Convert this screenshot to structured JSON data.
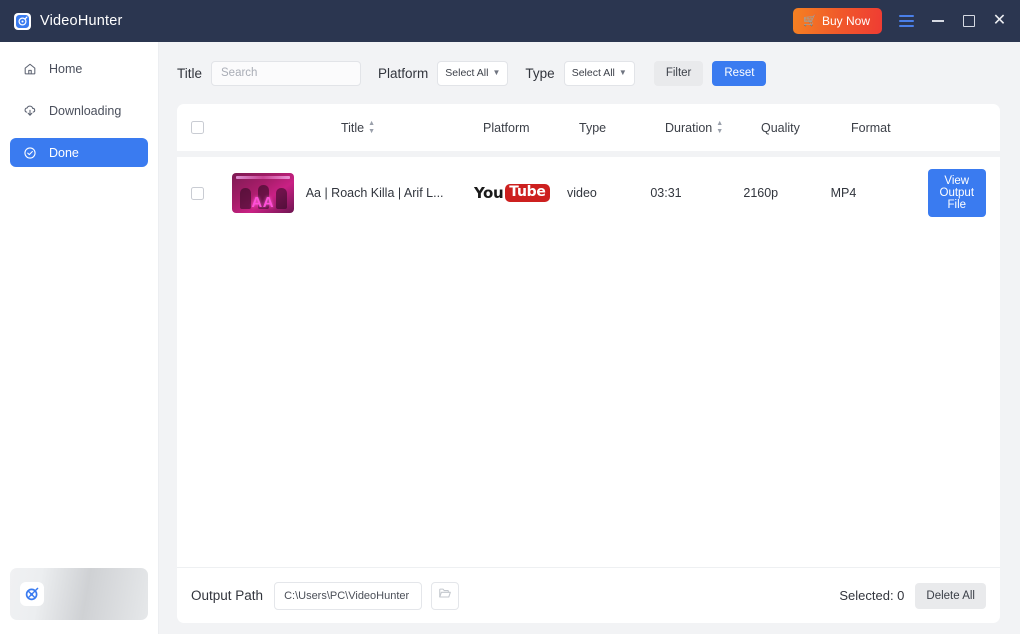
{
  "titlebar": {
    "app_name": "VideoHunter",
    "logo_icon": "videohunter-logo-icon",
    "buy_now_label": "Buy Now",
    "cart_icon": "cart-icon",
    "menu_icon": "hamburger-menu-icon",
    "minimize_icon": "minimize-icon",
    "maximize_icon": "maximize-icon",
    "close_icon": "close-icon",
    "close_glyph": "✕",
    "bg_color": "#2b3650",
    "buy_now_gradient": [
      "#f58122",
      "#ef3c33"
    ]
  },
  "sidebar": {
    "items": [
      {
        "label": "Home",
        "icon": "home-icon",
        "active": false
      },
      {
        "label": "Downloading",
        "icon": "download-cloud-icon",
        "active": false
      },
      {
        "label": "Done",
        "icon": "check-circle-icon",
        "active": true
      }
    ],
    "active_color": "#3a7bf0",
    "promo": {
      "icon": "promo-app-icon"
    }
  },
  "filter_bar": {
    "title_label": "Title",
    "search_placeholder": "Search",
    "search_value": "",
    "platform_label": "Platform",
    "platform_value": "Select All",
    "type_label": "Type",
    "type_value": "Select All",
    "filter_button": "Filter",
    "reset_button": "Reset",
    "reset_color": "#3a7bf0"
  },
  "table": {
    "select_all_checked": false,
    "headers": {
      "title": "Title",
      "platform": "Platform",
      "type": "Type",
      "duration": "Duration",
      "quality": "Quality",
      "format": "Format"
    },
    "rows": [
      {
        "checked": false,
        "thumbnail_text": "AA",
        "title": "Aa | Roach Killa | Arif L...",
        "platform": "YouTube",
        "platform_logo_part1": "You",
        "platform_logo_part2": "Tube",
        "type": "video",
        "duration": "03:31",
        "quality": "2160p",
        "format": "MP4",
        "action_label": "View Output File"
      }
    ]
  },
  "footer": {
    "output_path_label": "Output Path",
    "output_path_value": "C:\\Users\\PC\\VideoHunter",
    "browse_icon": "folder-open-icon",
    "selected_label": "Selected: 0",
    "delete_all_label": "Delete All"
  }
}
